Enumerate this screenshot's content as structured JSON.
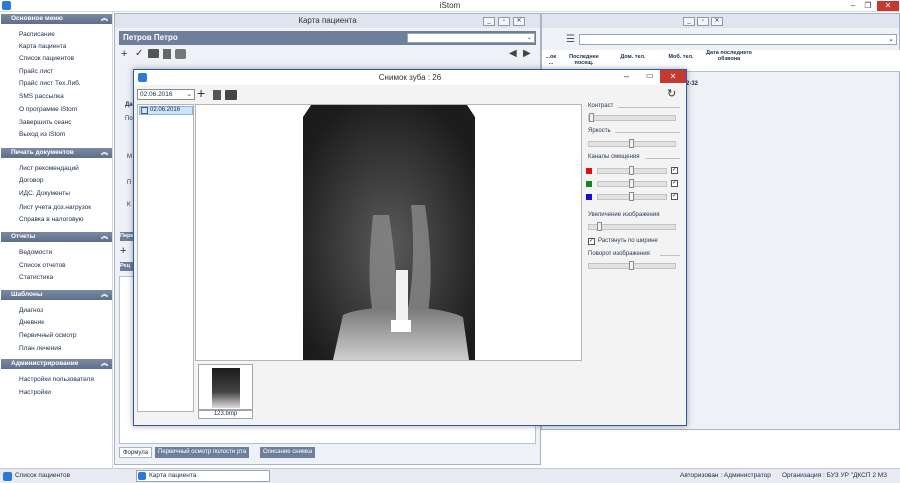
{
  "app": {
    "title": "iStom"
  },
  "sidebar": {
    "sections": [
      {
        "title": "Основное меню",
        "items": [
          "Расписание",
          "Карта пациента",
          "Список пациентов",
          "Прайс лист",
          "Прайс лист Тех.Либ.",
          "SMS рассылка",
          "О программе  iStom",
          "Завершить сеанс",
          "Выход из iStom"
        ]
      },
      {
        "title": "Печать документов",
        "items": [
          "Лист рекомендаций",
          "Договор",
          "ИДС. Документы",
          "Лист учета доз.нагрузок",
          "Справка в налоговую"
        ]
      },
      {
        "title": "Отчеты",
        "items": [
          "Ведомости",
          "Список отчетов",
          "Статистика"
        ]
      },
      {
        "title": "Шаблоны",
        "items": [
          "Диагноз",
          "Дневник",
          "Первичный осмотр",
          "План лечения"
        ]
      },
      {
        "title": "Администрирование",
        "items": [
          "Настройки пользователя",
          "Настройки"
        ]
      }
    ]
  },
  "card": {
    "title": "Карта пациента",
    "patient": "Петров Петро",
    "frag_left": [
      "Да",
      "По",
      "М",
      "П",
      "К"
    ],
    "tabs": [
      "Формула",
      "Первичный осмотр полости рта",
      "Описание снимка"
    ],
    "frag_labels": [
      "Перв",
      "Рец"
    ]
  },
  "list": {
    "columns": [
      "...ое ...",
      "Последнее посещ.",
      "Дом. тел.",
      "Моб. тел.",
      "Дата последнего обзвона"
    ],
    "row_frag": "2-32"
  },
  "dialog": {
    "title": "Снимок зуба : 26",
    "date_select": "02.06.2016",
    "date_item": "02.06.2016",
    "thumb_label": "123.bmp",
    "controls": {
      "contrast": {
        "label": "Контраст",
        "value": 0
      },
      "brightness": {
        "label": "Яркость",
        "value": 0.5
      },
      "channels": {
        "label": "Каналы смещения",
        "items": [
          {
            "color": "#e01010",
            "value": 0.5,
            "checked": true
          },
          {
            "color": "#148a14",
            "value": 0.5,
            "checked": true
          },
          {
            "color": "#1010d0",
            "value": 0.5,
            "checked": true
          }
        ]
      },
      "zoom": {
        "label": "Увеличение изображения",
        "value": 0.1
      },
      "stretch": {
        "label": "Растянуть по ширине",
        "checked": true
      },
      "rotate": {
        "label": "Поворот изображения",
        "value": 0.5
      }
    }
  },
  "status": {
    "left_item": "Список пациентов",
    "task_item": "Карта пациента",
    "auth": "Авторизован : Администратор",
    "org": "Организация : БУЗ УР \"ДКСП 2 МЗ"
  }
}
